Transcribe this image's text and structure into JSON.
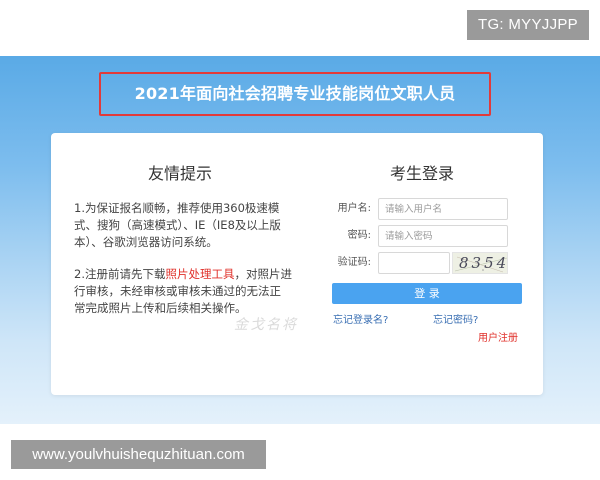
{
  "overlay": {
    "tg_badge": "TG: MYYJJPP",
    "url_badge": "www.youlvhuishequzhituan.com"
  },
  "header": {
    "title": "2021年面向社会招聘专业技能岗位文职人员"
  },
  "tips": {
    "title": "友情提示",
    "item1": "1.为保证报名顺畅，推荐使用360极速模式、搜狗（高速模式）、IE（IE8及以上版本）、谷歌浏览器访问系统。",
    "item2_before": "2.注册前请先下载",
    "item2_link": "照片处理工具",
    "item2_after": "，对照片进行审核，未经审核或审核未通过的无法正常完成照片上传和后续相关操作。",
    "watermark": "金戈名将"
  },
  "login": {
    "title": "考生登录",
    "username_label": "用户名:",
    "username_placeholder": "请输入用户名",
    "password_label": "密码:",
    "password_placeholder": "请输入密码",
    "captcha_label": "验证码:",
    "captcha_value": "8354",
    "submit_label": "登 录",
    "forgot_username": "忘记登录名?",
    "forgot_password": "忘记密码?",
    "register": "用户注册"
  },
  "colors": {
    "banner_top": "#5aaae6",
    "banner_bottom": "#e4f1fb",
    "title_border": "#e23a3a",
    "button": "#4aa3f0",
    "link_red": "#e0302a",
    "link_blue": "#3a6fb3"
  }
}
